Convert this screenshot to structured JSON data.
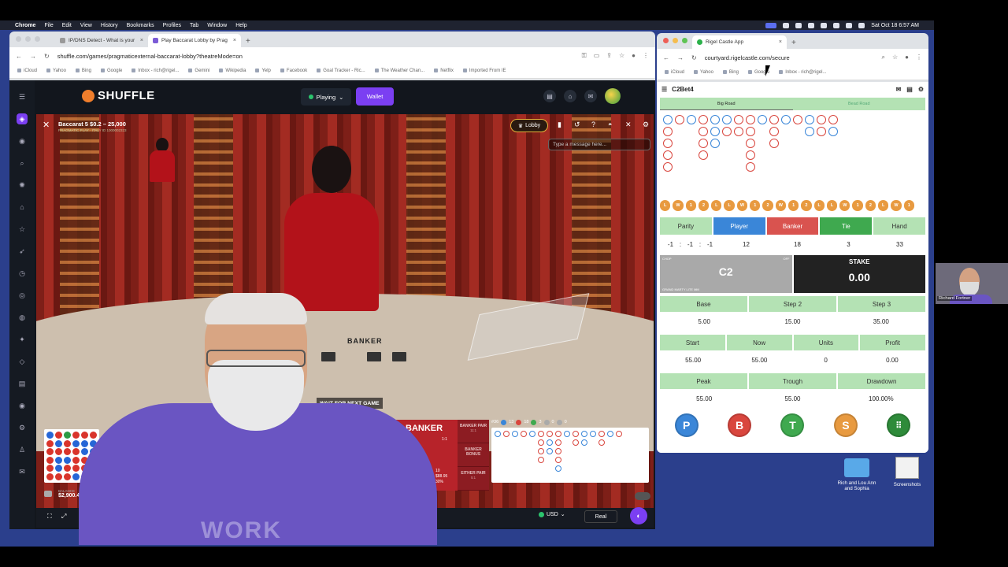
{
  "menubar": {
    "items": [
      "Chrome",
      "File",
      "Edit",
      "View",
      "History",
      "Bookmarks",
      "Profiles",
      "Tab",
      "Window",
      "Help"
    ],
    "clock": "Sat Oct 18  6:57 AM"
  },
  "left_browser": {
    "tabs": [
      {
        "label": "IP/DNS Detect - What is your"
      },
      {
        "label": "Play Baccarat Lobby by Prag"
      }
    ],
    "url": "shuffle.com/games/pragmaticexternal-baccarat-lobby?theatreMode=on",
    "bookmarks": [
      "iCloud",
      "Yahoo",
      "Bing",
      "Google",
      "Inbox - rich@rigel...",
      "Gemini",
      "Wikipedia",
      "Yelp",
      "Facebook",
      "Goal Tracker - Ric...",
      "The Weather Chan...",
      "Netflix",
      "Imported From IE"
    ]
  },
  "site": {
    "logo": "SHUFFLE",
    "playing_label": "Playing",
    "wallet_label": "Wallet"
  },
  "game": {
    "title": "Baccarat 5  $0.2 – 25,000",
    "subtitle": "PRAGMATIC PLAY · ITALY ID 1000002323",
    "lobby_label": "Lobby",
    "chat_placeholder": "Type a message here...",
    "table_sign": "BANKER",
    "status": "WAIT FOR NEXT GAME",
    "bet_banker": {
      "label": "BANKER",
      "odds": "1:1",
      "s1": "10",
      "s2": "$88.95",
      "s3": "30%"
    },
    "side_bets": [
      {
        "label": "BANKER PAIR",
        "odds": "11:1"
      },
      {
        "label": "BANKER BONUS",
        "odds": ""
      },
      {
        "label": "EITHER PAIR",
        "odds": "5:1"
      }
    ],
    "road_counts": {
      "round": "#36",
      "player": "13",
      "banker": "18",
      "tie": "3",
      "bp": "0",
      "pp": "0"
    },
    "balance_label": "BALANCE",
    "balance_value": "$2,900.47",
    "currency": "USD",
    "mode": "Real"
  },
  "right_browser": {
    "tab": "Rigel Castle App",
    "url": "courtyard.rigelcastle.com/secure",
    "bookmarks": [
      "iCloud",
      "Yahoo",
      "Bing",
      "Google",
      "Inbox - rich@rigel..."
    ]
  },
  "app": {
    "title": "C2Bet4",
    "road_tabs": [
      "Big Road",
      "Bead Road"
    ],
    "history": [
      "L",
      "W",
      "1",
      "2",
      "L",
      "L",
      "W",
      "1",
      "2",
      "W",
      "1",
      "2",
      "L",
      "L",
      "W",
      "1",
      "2",
      "L",
      "W",
      "1"
    ],
    "totals_headers": [
      "Parity",
      "Player",
      "Banker",
      "Tie",
      "Hand"
    ],
    "parity": [
      "-1",
      ":",
      "-1",
      ":",
      "-1"
    ],
    "totals": {
      "player": "12",
      "banker": "18",
      "tie": "3",
      "hand": "33"
    },
    "system": {
      "chop": "CHOP",
      "off": "OFF",
      "name": "C2",
      "sub": "GRAND MARTY LITE MM"
    },
    "stake_label": "STAKE",
    "stake_value": "0.00",
    "row1_headers": [
      "Base",
      "Step 2",
      "Step 3"
    ],
    "row1_values": [
      "5.00",
      "15.00",
      "35.00"
    ],
    "row2_headers": [
      "Start",
      "Now",
      "Units",
      "Profit"
    ],
    "row2_values": [
      "55.00",
      "55.00",
      "0",
      "0.00"
    ],
    "row3_headers": [
      "Peak",
      "Trough",
      "Drawdown"
    ],
    "row3_values": [
      "55.00",
      "55.00",
      "100.00%"
    ],
    "buttons": [
      "P",
      "B",
      "T",
      "S",
      "⠿"
    ]
  },
  "desktop": {
    "folder_label": "Rich and Lou Ann and Sophia",
    "screenshots_label": "Screenshots"
  },
  "webcam": {
    "name": "Richard Fortner"
  },
  "colors": {
    "player": "#3a86d8",
    "banker": "#d9463e",
    "tie": "#3fa94f",
    "accent": "#7b3ff2"
  }
}
